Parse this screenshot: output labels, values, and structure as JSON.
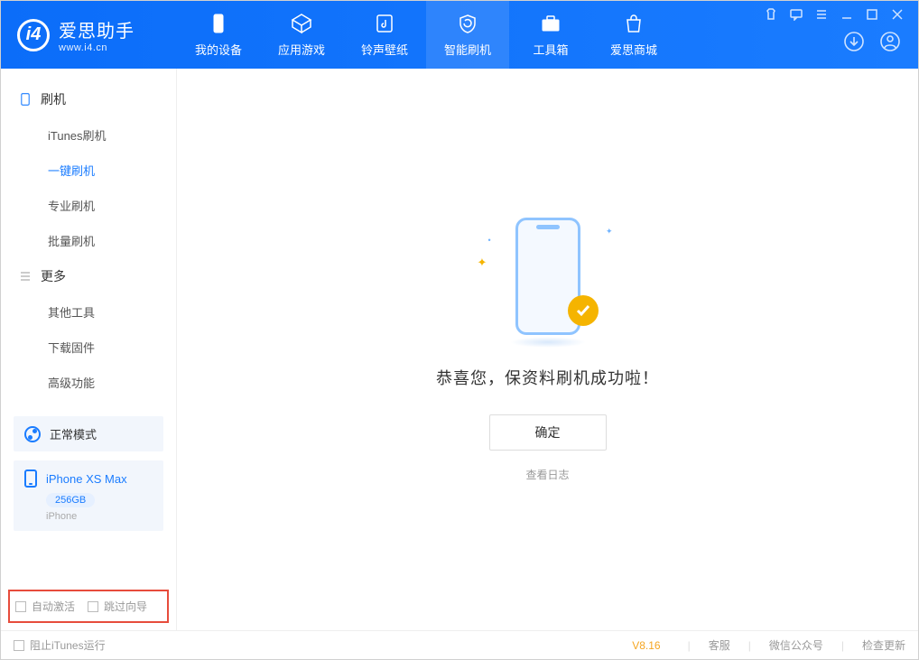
{
  "brand": {
    "name": "爱思助手",
    "url": "www.i4.cn"
  },
  "top_tabs": [
    {
      "label": "我的设备"
    },
    {
      "label": "应用游戏"
    },
    {
      "label": "铃声壁纸"
    },
    {
      "label": "智能刷机"
    },
    {
      "label": "工具箱"
    },
    {
      "label": "爱思商城"
    }
  ],
  "sidebar": {
    "group1": {
      "title": "刷机",
      "items": [
        "iTunes刷机",
        "一键刷机",
        "专业刷机",
        "批量刷机"
      ]
    },
    "group2": {
      "title": "更多",
      "items": [
        "其他工具",
        "下载固件",
        "高级功能"
      ]
    }
  },
  "mode": {
    "label": "正常模式"
  },
  "device": {
    "name": "iPhone XS Max",
    "storage": "256GB",
    "type": "iPhone"
  },
  "bottom_opts": {
    "auto_activate": "自动激活",
    "skip_guide": "跳过向导"
  },
  "main": {
    "success_msg": "恭喜您，保资料刷机成功啦！",
    "ok": "确定",
    "view_log": "查看日志"
  },
  "footer": {
    "block_itunes": "阻止iTunes运行",
    "version": "V8.16",
    "links": [
      "客服",
      "微信公众号",
      "检查更新"
    ]
  }
}
